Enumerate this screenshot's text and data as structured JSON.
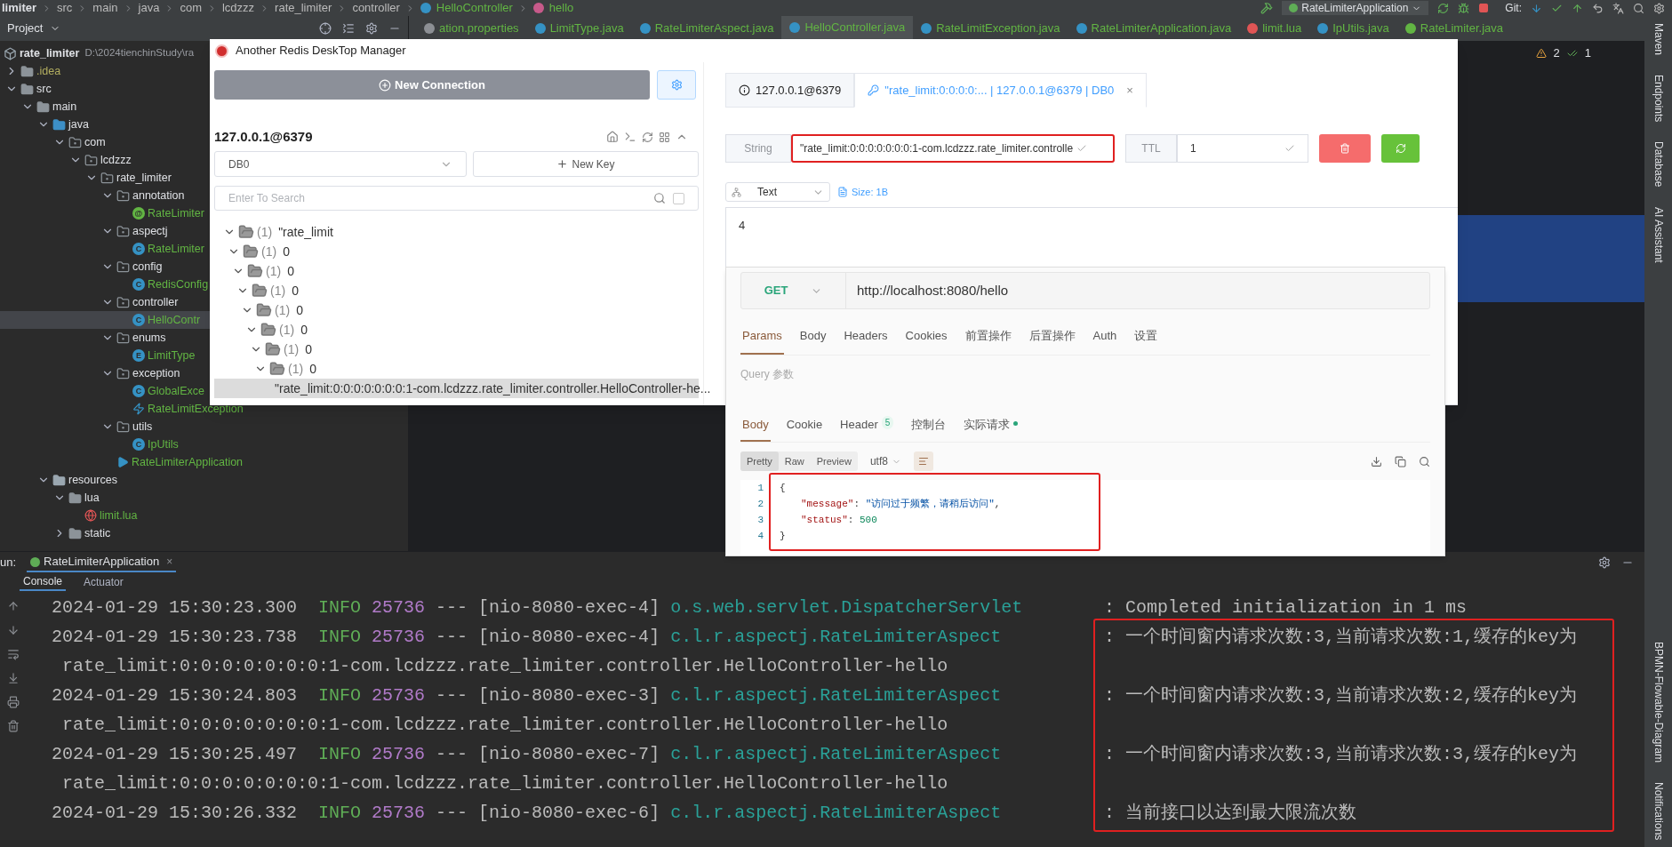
{
  "ide": {
    "breadcrumbs": [
      {
        "label": "limiter",
        "kind": "project"
      },
      {
        "label": "src",
        "kind": "plain"
      },
      {
        "label": "main",
        "kind": "plain"
      },
      {
        "label": "java",
        "kind": "plain"
      },
      {
        "label": "com",
        "kind": "plain"
      },
      {
        "label": "lcdzzz",
        "kind": "plain"
      },
      {
        "label": "rate_limiter",
        "kind": "plain"
      },
      {
        "label": "controller",
        "kind": "plain"
      },
      {
        "label": "HelloController",
        "kind": "class"
      },
      {
        "label": "hello",
        "kind": "method"
      }
    ],
    "run_config": "RateLimiterApplication",
    "vcs_label": "Git:",
    "project_dropdown": "Project",
    "editor_tabs": [
      {
        "label": "ation.properties",
        "kind": "properties",
        "selected": false
      },
      {
        "label": "LimitType.java",
        "kind": "class",
        "selected": false
      },
      {
        "label": "RateLimiterAspect.java",
        "kind": "class",
        "selected": false
      },
      {
        "label": "HelloController.java",
        "kind": "class",
        "selected": true
      },
      {
        "label": "RateLimitException.java",
        "kind": "class",
        "selected": false
      },
      {
        "label": "RateLimiterApplication.java",
        "kind": "class",
        "selected": false
      },
      {
        "label": "limit.lua",
        "kind": "lua",
        "selected": false
      },
      {
        "label": "IpUtils.java",
        "kind": "class",
        "selected": false
      },
      {
        "label": "RateLimiter.java",
        "kind": "annotation",
        "selected": false
      }
    ],
    "inspections": {
      "warnings": "2",
      "passed": "1"
    },
    "project_tree": {
      "name": "rate_limiter",
      "path": "D:\\2024tienchinStudy\\ra",
      "kind": "module",
      "selected": false,
      "children": [
        {
          "name": ".idea",
          "kind": "excluded",
          "expanded": false,
          "selected": false
        },
        {
          "name": "src",
          "kind": "folder",
          "expanded": true,
          "selected": false,
          "children": [
            {
              "name": "main",
              "kind": "folder",
              "expanded": true,
              "selected": false,
              "children": [
                {
                  "name": "java",
                  "kind": "source",
                  "expanded": true,
                  "selected": false,
                  "children": [
                    {
                      "name": "com",
                      "kind": "package",
                      "expanded": true,
                      "selected": false,
                      "children": [
                        {
                          "name": "lcdzzz",
                          "kind": "package",
                          "expanded": true,
                          "selected": false,
                          "children": [
                            {
                              "name": "rate_limiter",
                              "kind": "package",
                              "expanded": true,
                              "selected": false,
                              "children": [
                                {
                                  "name": "annotation",
                                  "kind": "package",
                                  "expanded": true,
                                  "selected": false,
                                  "children": [
                                    {
                                      "name": "RateLimiter",
                                      "kind": "annotation",
                                      "badge": "@",
                                      "selected": false
                                    }
                                  ]
                                },
                                {
                                  "name": "aspectj",
                                  "kind": "package",
                                  "expanded": true,
                                  "selected": false,
                                  "children": [
                                    {
                                      "name": "RateLimiter",
                                      "kind": "class",
                                      "badge": "C",
                                      "selected": false
                                    }
                                  ]
                                },
                                {
                                  "name": "config",
                                  "kind": "package",
                                  "expanded": true,
                                  "selected": false,
                                  "children": [
                                    {
                                      "name": "RedisConfig",
                                      "kind": "class",
                                      "badge": "C",
                                      "selected": false
                                    }
                                  ]
                                },
                                {
                                  "name": "controller",
                                  "kind": "package",
                                  "expanded": true,
                                  "selected": false,
                                  "children": [
                                    {
                                      "name": "HelloContr",
                                      "kind": "class",
                                      "badge": "C",
                                      "selected": true
                                    }
                                  ]
                                },
                                {
                                  "name": "enums",
                                  "kind": "package",
                                  "expanded": true,
                                  "selected": false,
                                  "children": [
                                    {
                                      "name": "LimitType",
                                      "kind": "enum",
                                      "badge": "E",
                                      "selected": false
                                    }
                                  ]
                                },
                                {
                                  "name": "exception",
                                  "kind": "package",
                                  "expanded": true,
                                  "selected": false,
                                  "children": [
                                    {
                                      "name": "GlobalExce",
                                      "kind": "class",
                                      "badge": "C",
                                      "selected": false
                                    },
                                    {
                                      "name": "RateLimitException",
                                      "kind": "exception",
                                      "selected": false
                                    }
                                  ]
                                },
                                {
                                  "name": "utils",
                                  "kind": "package",
                                  "expanded": true,
                                  "selected": false,
                                  "children": [
                                    {
                                      "name": "IpUtils",
                                      "kind": "class",
                                      "badge": "C",
                                      "selected": false
                                    }
                                  ]
                                },
                                {
                                  "name": "RateLimiterApplication",
                                  "kind": "app",
                                  "selected": false
                                }
                              ]
                            }
                          ]
                        }
                      ]
                    }
                  ]
                },
                {
                  "name": "resources",
                  "kind": "resource",
                  "expanded": true,
                  "selected": false,
                  "children": [
                    {
                      "name": "lua",
                      "kind": "folder",
                      "expanded": true,
                      "selected": false,
                      "children": [
                        {
                          "name": "limit.lua",
                          "kind": "lua",
                          "selected": false
                        }
                      ]
                    },
                    {
                      "name": "static",
                      "kind": "folder",
                      "expanded": false,
                      "selected": false
                    }
                  ]
                }
              ]
            }
          ]
        }
      ]
    },
    "right_tools_top": [
      "Maven",
      "Endpoints",
      "Database",
      "AI Assistant"
    ],
    "right_tools_bottom": [
      "BPMN-Flowable-Diagram",
      "Notifications"
    ],
    "run_panel": {
      "label": "un:",
      "run_tab": "RateLimiterApplication",
      "run_tab_close": "×",
      "highlighted": true,
      "tabs": [
        {
          "label": "Console",
          "selected": true
        },
        {
          "label": "Actuator",
          "selected": false
        }
      ],
      "log": [
        {
          "kind": "entry",
          "time": "2024-01-29 15:30:23.300",
          "level": "INFO",
          "pid": "25736",
          "sep": "---",
          "thread": "[nio-8080-exec-4]",
          "logger": "o.s.web.servlet.DispatcherServlet",
          "message": ": Completed initialization in 1 ms"
        },
        {
          "kind": "entry",
          "time": "2024-01-29 15:30:23.738",
          "level": "INFO",
          "pid": "25736",
          "sep": "---",
          "thread": "[nio-8080-exec-4]",
          "logger": "c.l.r.aspectj.RateLimiterAspect",
          "message": ": 一个时间窗内请求次数:3,当前请求次数:1,缓存的key为"
        },
        {
          "kind": "continuation",
          "text": "rate_limit:0:0:0:0:0:0:0:1-com.lcdzzz.rate_limiter.controller.HelloController-hello"
        },
        {
          "kind": "entry",
          "time": "2024-01-29 15:30:24.803",
          "level": "INFO",
          "pid": "25736",
          "sep": "---",
          "thread": "[nio-8080-exec-3]",
          "logger": "c.l.r.aspectj.RateLimiterAspect",
          "message": ": 一个时间窗内请求次数:3,当前请求次数:2,缓存的key为"
        },
        {
          "kind": "continuation",
          "text": "rate_limit:0:0:0:0:0:0:0:1-com.lcdzzz.rate_limiter.controller.HelloController-hello"
        },
        {
          "kind": "entry",
          "time": "2024-01-29 15:30:25.497",
          "level": "INFO",
          "pid": "25736",
          "sep": "---",
          "thread": "[nio-8080-exec-7]",
          "logger": "c.l.r.aspectj.RateLimiterAspect",
          "message": ": 一个时间窗内请求次数:3,当前请求次数:3,缓存的key为"
        },
        {
          "kind": "continuation",
          "text": "rate_limit:0:0:0:0:0:0:0:1-com.lcdzzz.rate_limiter.controller.HelloController-hello"
        },
        {
          "kind": "entry",
          "time": "2024-01-29 15:30:26.332",
          "level": "INFO",
          "pid": "25736",
          "sep": "---",
          "thread": "[nio-8080-exec-6]",
          "logger": "c.l.r.aspectj.RateLimiterAspect",
          "message": ": 当前接口以达到最大限流次数"
        }
      ]
    }
  },
  "redis_window": {
    "title": "Another Redis DeskTop Manager",
    "new_connection": "New Connection",
    "connection": "127.0.0.1@6379",
    "db": "DB0",
    "new_key": "New Key",
    "search_placeholder": "Enter To Search",
    "exact_search": {
      "checked": false
    },
    "key_tree": {
      "count": "(1)",
      "name": "\"rate_limit",
      "expanded": true,
      "selected": false,
      "children": [
        {
          "count": "(1)",
          "name": "0",
          "expanded": true,
          "selected": false,
          "children": [
            {
              "count": "(1)",
              "name": "0",
              "expanded": true,
              "selected": false,
              "children": [
                {
                  "count": "(1)",
                  "name": "0",
                  "expanded": true,
                  "selected": false,
                  "children": [
                    {
                      "count": "(1)",
                      "name": "0",
                      "expanded": true,
                      "selected": false,
                      "children": [
                        {
                          "count": "(1)",
                          "name": "0",
                          "expanded": true,
                          "selected": false,
                          "children": [
                            {
                              "count": "(1)",
                              "name": "0",
                              "expanded": true,
                              "selected": false,
                              "children": [
                                {
                                  "count": "(1)",
                                  "name": "0",
                                  "expanded": true,
                                  "selected": false,
                                  "children": [
                                    {
                                      "name": "\"rate_limit:0:0:0:0:0:0:0:1-com.lcdzzz.rate_limiter.controller.HelloController-he...",
                                      "selected": true
                                    }
                                  ]
                                }
                              ]
                            }
                          ]
                        }
                      ]
                    }
                  ]
                }
              ]
            }
          ]
        }
      ]
    },
    "tabs": [
      {
        "label": "127.0.0.1@6379",
        "kind": "info",
        "selected": false
      },
      {
        "label": "\"rate_limit:0:0:0:0:... | 127.0.0.1@6379 | DB0",
        "kind": "key",
        "selected": true,
        "close": "×"
      }
    ],
    "key_type": "String",
    "key_name": "\"rate_limit:0:0:0:0:0:0:0:1-com.lcdzzz.rate_limiter.controlle",
    "key_name_highlighted": true,
    "ttl_label": "TTL",
    "ttl": "1",
    "format": "Text",
    "size": "Size: 1B",
    "value": "4"
  },
  "api_client": {
    "method": "GET",
    "url": "http://localhost:8080/hello",
    "request_tabs": [
      {
        "label": "Params",
        "selected": true
      },
      {
        "label": "Body",
        "selected": false
      },
      {
        "label": "Headers",
        "selected": false
      },
      {
        "label": "Cookies",
        "selected": false
      },
      {
        "label": "前置操作",
        "selected": false
      },
      {
        "label": "后置操作",
        "selected": false
      },
      {
        "label": "Auth",
        "selected": false
      },
      {
        "label": "设置",
        "selected": false
      }
    ],
    "query_label": "Query 参数",
    "response_tabs": [
      {
        "label": "Body",
        "selected": true
      },
      {
        "label": "Cookie",
        "selected": false
      },
      {
        "label": "Header",
        "badge": "5",
        "selected": false
      },
      {
        "label": "控制台",
        "selected": false
      },
      {
        "label": "实际请求",
        "dot": true,
        "selected": false
      }
    ],
    "view_modes": [
      {
        "label": "Pretty",
        "selected": true
      },
      {
        "label": "Raw",
        "selected": false
      },
      {
        "label": "Preview",
        "selected": false
      }
    ],
    "encoding": "utf8",
    "body_highlighted": true,
    "body_lines": [
      {
        "number": "1",
        "tokens": [
          {
            "kind": "punct",
            "text": "{"
          }
        ]
      },
      {
        "number": "2",
        "tokens": [
          {
            "kind": "key",
            "text": "\"message\""
          },
          {
            "kind": "punct",
            "text": ": "
          },
          {
            "kind": "string",
            "text": "\"访问过于频繁，请稍后访问\""
          },
          {
            "kind": "punct",
            "text": ","
          }
        ]
      },
      {
        "number": "3",
        "tokens": [
          {
            "kind": "key",
            "text": "\"status\""
          },
          {
            "kind": "punct",
            "text": ": "
          },
          {
            "kind": "number",
            "text": "500"
          }
        ]
      },
      {
        "number": "4",
        "tokens": [
          {
            "kind": "punct",
            "text": "}"
          }
        ]
      }
    ]
  }
}
